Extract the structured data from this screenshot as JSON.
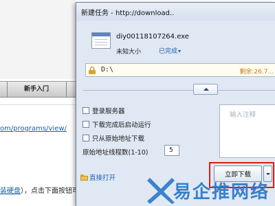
{
  "background_page": {
    "nav_item": "新手入门",
    "url_fragment": "om/programs/view/",
    "text_line_link": "装硬盘",
    "text_line_rest": "），点击下面按钮可立即下载"
  },
  "dialog": {
    "title": "新建任务 - http://download..",
    "file": {
      "name": "diy00118107264.exe",
      "size": "未知大小",
      "status": "已完成",
      "status_caret": "▾"
    },
    "path": {
      "value": "D:\\",
      "free_space": "剩余:26.7..."
    },
    "options": [
      {
        "label": "登录服务器",
        "checked": false
      },
      {
        "label": "下载完成后启动运行",
        "checked": false
      },
      {
        "label": "只从原始地址下载",
        "checked": false
      }
    ],
    "threads": {
      "label": "原始地址线程数(1-10)",
      "value": "5"
    },
    "note": {
      "placeholder": "输入注释"
    },
    "open_dir_label": "直接打开",
    "download_button_label": "立即下载"
  },
  "watermark": {
    "text": "易企推网络"
  },
  "colors": {
    "dialog_bg": "#dfe8f3",
    "link_blue": "#1d5fb4",
    "highlight_red": "#e01818",
    "watermark_blue": "#2a78c8",
    "free_space_orange": "#c57a16"
  }
}
